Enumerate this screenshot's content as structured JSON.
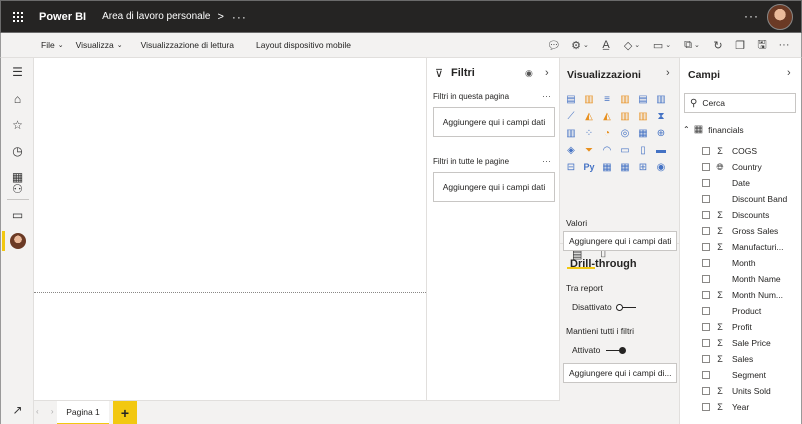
{
  "header": {
    "app_title": "Power BI",
    "workspace": "Area di lavoro personale",
    "chevron": ">",
    "workspace_more": "···",
    "more": "···"
  },
  "commandbar": {
    "menus": [
      {
        "label": "File",
        "caret": true
      },
      {
        "label": "Visualizza",
        "caret": true
      },
      {
        "label": "Visualizzazione di lettura",
        "caret": false
      },
      {
        "label": "Layout dispositivo mobile",
        "caret": false
      }
    ],
    "icons": [
      "comment-icon",
      "visual-interactions-icon",
      "textbox-icon",
      "shapes-icon",
      "buttons-icon",
      "paginated-icon",
      "refresh-icon",
      "duplicate-icon",
      "save-icon",
      "more-icon"
    ],
    "more": "···"
  },
  "leftnav": {
    "items": [
      "menu-icon",
      "home-icon",
      "favorites-icon",
      "recent-icon",
      "apps-icon",
      "shared-icon",
      "workspaces-icon",
      "my-workspace-avatar",
      "expand-icon"
    ]
  },
  "pages": {
    "tabs": [
      {
        "label": "Pagina 1",
        "active": true
      }
    ],
    "add_label": "+"
  },
  "filters": {
    "title": "Filtri",
    "sections": [
      {
        "label": "Filtri in questa pagina",
        "more": "···",
        "drop_label": "Aggiungere qui i campi dati"
      },
      {
        "label": "Filtri in tutte le pagine",
        "more": "···",
        "drop_label": "Aggiungere qui i campi dati"
      }
    ]
  },
  "visualizations": {
    "title": "Visualizzazioni",
    "more": "···",
    "values_label": "Valori",
    "values_drop": "Aggiungere qui i campi dati",
    "drillthrough": {
      "title": "Drill-through",
      "cross_report_label": "Tra report",
      "cross_report_state": "Disattivato",
      "keep_filters_label": "Mantieni tutti i filtri",
      "keep_filters_state": "Attivato",
      "drop_label": "Aggiungere qui i campi di..."
    }
  },
  "fields": {
    "title": "Campi",
    "search_placeholder": "Cerca",
    "table_name": "financials",
    "items": [
      {
        "name": "COGS",
        "type": "sigma"
      },
      {
        "name": "Country",
        "type": "globe"
      },
      {
        "name": "Date",
        "type": "none"
      },
      {
        "name": "Discount Band",
        "type": "none"
      },
      {
        "name": "Discounts",
        "type": "sigma"
      },
      {
        "name": "Gross Sales",
        "type": "sigma"
      },
      {
        "name": "Manufacturi...",
        "type": "sigma"
      },
      {
        "name": "Month",
        "type": "none"
      },
      {
        "name": "Month Name",
        "type": "none"
      },
      {
        "name": "Month Num...",
        "type": "sigma"
      },
      {
        "name": "Product",
        "type": "none"
      },
      {
        "name": "Profit",
        "type": "sigma"
      },
      {
        "name": "Sale Price",
        "type": "sigma"
      },
      {
        "name": "Sales",
        "type": "sigma"
      },
      {
        "name": "Segment",
        "type": "none"
      },
      {
        "name": "Units Sold",
        "type": "sigma"
      },
      {
        "name": "Year",
        "type": "sigma"
      }
    ]
  },
  "colors": {
    "accent": "#f2c811",
    "topbar": "#252423",
    "pane_gray": "#f3f2f1"
  }
}
